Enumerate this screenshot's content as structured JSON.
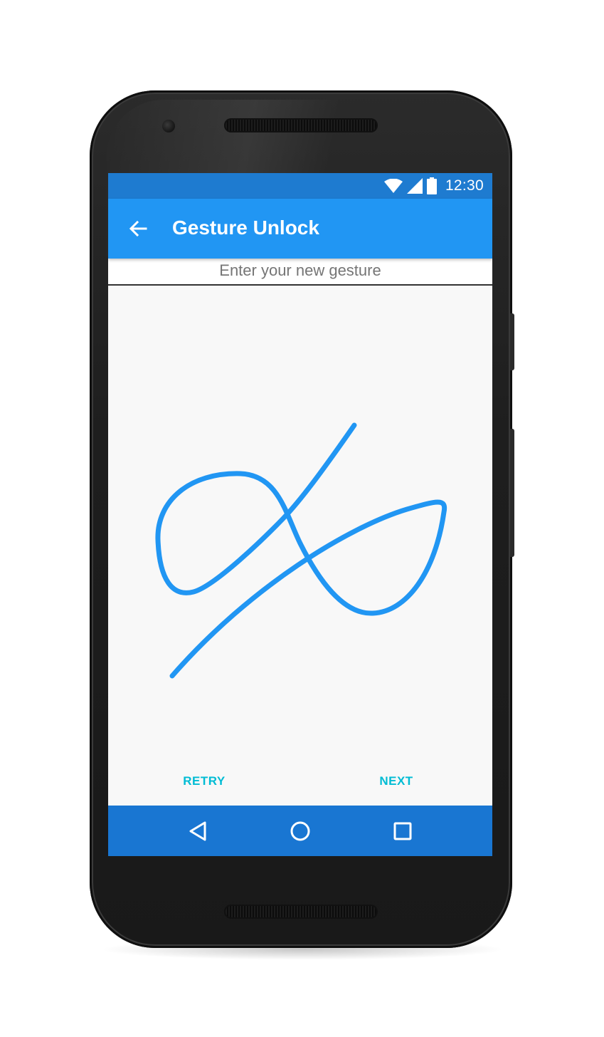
{
  "status_bar": {
    "time": "12:30",
    "icons": [
      "wifi-icon",
      "cell-signal-icon",
      "battery-icon"
    ],
    "color": "#1e7bd0"
  },
  "app_bar": {
    "title": "Gesture Unlock",
    "back_icon": "arrow-left-icon",
    "color": "#2196f3"
  },
  "instruction": {
    "text": "Enter your new gesture"
  },
  "gesture": {
    "stroke_color": "#2196f3"
  },
  "actions": {
    "retry_label": "RETRY",
    "next_label": "NEXT",
    "color": "#00bcd4"
  },
  "nav_bar": {
    "color": "#1976d2",
    "icons": [
      "nav-back-icon",
      "nav-home-icon",
      "nav-recents-icon"
    ]
  }
}
